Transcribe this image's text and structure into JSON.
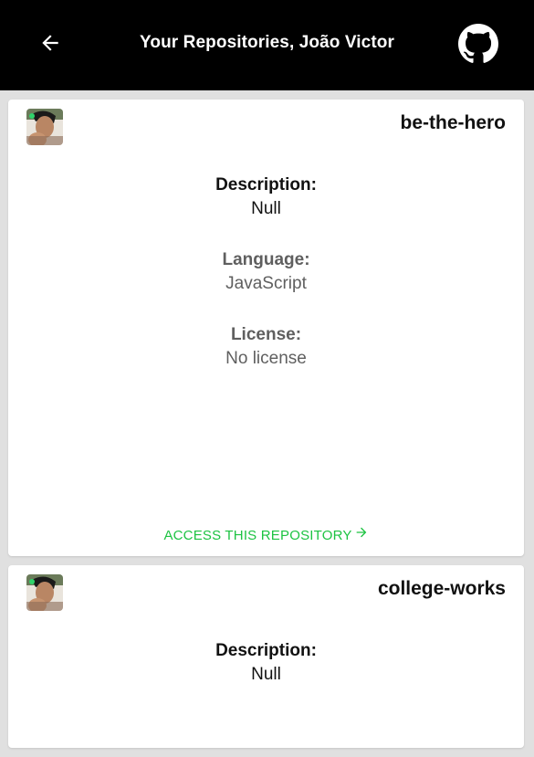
{
  "header": {
    "title": "Your Repositories, João Victor",
    "back_icon": "arrow-left-icon",
    "github_icon": "github-icon"
  },
  "colors": {
    "header_bg": "#000000",
    "page_bg": "#e0e0e0",
    "card_bg": "#ffffff",
    "accent": "#1dc342",
    "muted_text": "#5f5f5f"
  },
  "repositories": [
    {
      "name": "be-the-hero",
      "description_label": "Description:",
      "description": "Null",
      "language_label": "Language:",
      "language": "JavaScript",
      "license_label": "License:",
      "license": "No license",
      "access_label": "ACCESS THIS REPOSITORY"
    },
    {
      "name": "college-works",
      "description_label": "Description:",
      "description": "Null"
    }
  ]
}
